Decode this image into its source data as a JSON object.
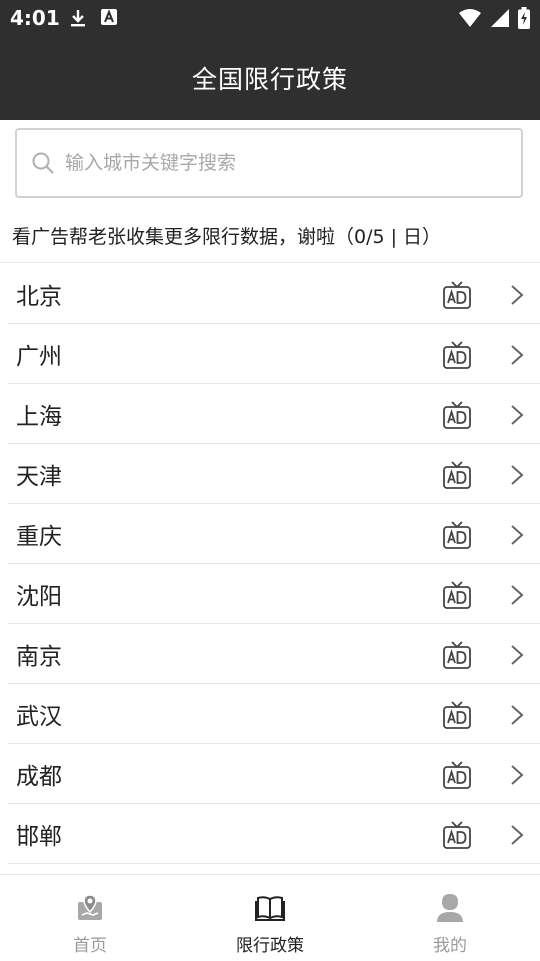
{
  "status_bar": {
    "time": "4:01",
    "icons": [
      "download-icon",
      "a-notification-icon",
      "wifi-icon",
      "signal-icon",
      "battery-icon"
    ]
  },
  "header": {
    "title": "全国限行政策"
  },
  "search": {
    "placeholder": "输入城市关键字搜索",
    "value": ""
  },
  "notice": {
    "text": "看广告帮老张收集更多限行数据，谢啦（0/5 | 日）"
  },
  "cities": [
    {
      "name": "北京"
    },
    {
      "name": "广州"
    },
    {
      "name": "上海"
    },
    {
      "name": "天津"
    },
    {
      "name": "重庆"
    },
    {
      "name": "沈阳"
    },
    {
      "name": "南京"
    },
    {
      "name": "武汉"
    },
    {
      "name": "成都"
    },
    {
      "name": "邯郸"
    }
  ],
  "bottom_nav": {
    "items": [
      {
        "label": "首页",
        "icon": "home-icon",
        "active": false
      },
      {
        "label": "限行政策",
        "icon": "book-icon",
        "active": true
      },
      {
        "label": "我的",
        "icon": "user-icon",
        "active": false
      }
    ]
  },
  "colors": {
    "header_bg": "#2f2f2f",
    "text": "#222222",
    "muted": "#9a9a9a"
  }
}
